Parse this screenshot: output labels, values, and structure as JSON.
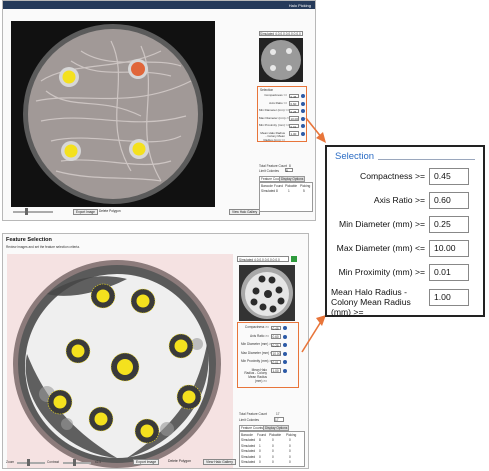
{
  "top_window": {
    "title": "Halo Picking",
    "buttons": {
      "export_image": "Export Image",
      "delete_polygon": "Delete Polygon",
      "view_halo_gallery": "View Halo Gallery"
    },
    "image_selector_value": "Simulated 4,0,0,0,0,0,0,0,0,0",
    "selection_label": "Selection",
    "fields": [
      {
        "label": "Compactness >=",
        "value": "0.45"
      },
      {
        "label": "Axis Ratio >=",
        "value": "0.60"
      },
      {
        "label": "Min Diameter (mm) >=",
        "value": "0.25"
      },
      {
        "label": "Max Diameter (mm) <=",
        "value": "10.00"
      },
      {
        "label": "Min Proximity (mm) >=",
        "value": "0.01"
      },
      {
        "label": "Mean Halo Radius - Colony Mean Radius (mm) >=",
        "value": "1.00"
      }
    ],
    "totals": {
      "total_feature_count_label": "Total Feature Count",
      "total_feature_count": "8",
      "limit_colonies_label": "Limit Colonies",
      "limit_colonies": "8"
    },
    "tabs": [
      "Feature Counts",
      "Display Options"
    ],
    "table_headers": [
      "Barcode",
      "Found",
      "Pickable",
      "Picking"
    ],
    "table_rows": [
      [
        "Simulated",
        "8",
        "1",
        "5"
      ]
    ]
  },
  "bottom_window": {
    "heading": "Feature Selection",
    "subheading": "Review images and set the feature selection criteria.",
    "image_selector_value": "Simulated 4,0,0,0,0,0,0,0,0,0",
    "buttons": {
      "export_image": "Export Image",
      "delete_polygon": "Delete Polygon",
      "view_halo_gallery": "View Halo Gallery"
    },
    "zoom_label": "Zoom",
    "contrast_label": "Contrast",
    "zoom_value": "x2.5",
    "fields": [
      {
        "label": "Compactness >=",
        "value": "0.45"
      },
      {
        "label": "Axis Ratio >=",
        "value": "0.60"
      },
      {
        "label": "Min Diameter (mm) >=",
        "value": "0.25"
      },
      {
        "label": "Max Diameter (mm) <=",
        "value": "10.00"
      },
      {
        "label": "Min Proximity (mm) >=",
        "value": "0.01"
      },
      {
        "label": "Mean Halo Radius - Colony Mean Radius (mm) >=",
        "value": "1.00"
      }
    ],
    "totals": {
      "total_feature_count_label": "Total Feature Count",
      "total_feature_count": "17",
      "limit_colonies_label": "Limit Colonies",
      "limit_colonies": "17"
    },
    "tabs": [
      "Feature Counts",
      "Display Options"
    ],
    "table_headers": [
      "Barcode",
      "Found",
      "Pickable",
      "Picking"
    ],
    "table_rows": [
      [
        "Simulated",
        "8",
        "0",
        "0"
      ],
      [
        "Simulated",
        "1",
        "0",
        "0"
      ],
      [
        "Simulated",
        "0",
        "0",
        "0"
      ],
      [
        "Simulated",
        "0",
        "0",
        "0"
      ],
      [
        "Simulated",
        "0",
        "0",
        "0"
      ]
    ]
  },
  "callout": {
    "title": "Selection",
    "fields": [
      {
        "label": "Compactness >=",
        "value": "0.45"
      },
      {
        "label": "Axis Ratio >=",
        "value": "0.60"
      },
      {
        "label": "Min Diameter (mm) >=",
        "value": "0.25"
      },
      {
        "label": "Max Diameter (mm) <=",
        "value": "10.00"
      },
      {
        "label": "Min Proximity (mm) >=",
        "value": "0.01"
      },
      {
        "label": "Mean Halo Radius - Colony Mean Radius (mm) >=",
        "value": "1.00"
      }
    ]
  },
  "colors": {
    "accent_orange": "#e8753a",
    "title_blue": "#2b6cc4",
    "colony_yellow": "#f4e11e",
    "highlight_orange": "#e0663a"
  }
}
